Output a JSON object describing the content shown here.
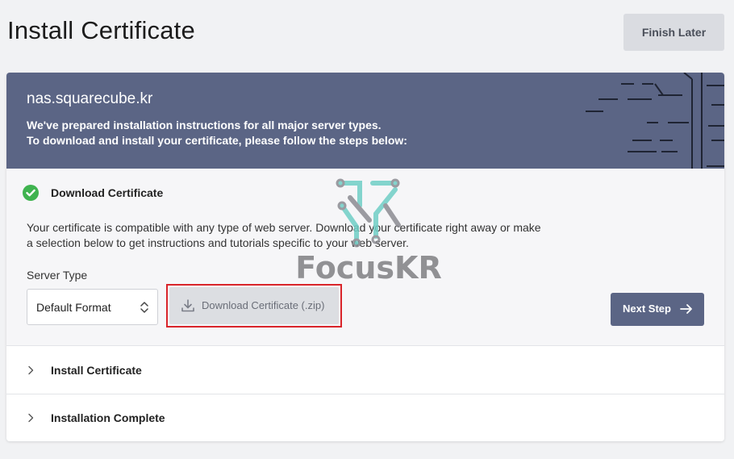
{
  "page": {
    "title": "Install Certificate",
    "finish_later": "Finish Later"
  },
  "banner": {
    "domain": "nas.squarecube.kr",
    "line1": "We've prepared installation instructions for all major server types.",
    "line2": "To download and install your certificate, please follow the steps below:"
  },
  "step1": {
    "title": "Download Certificate",
    "status_icon": "check-circle-icon",
    "description": "Your certificate is compatible with any type of web server. Download your certificate right away or make a selection below to get instructions and tutorials specific to your web server.",
    "server_type_label": "Server Type",
    "server_type_value": "Default Format",
    "download_label": "Download Certificate (.zip)",
    "next_label": "Next Step"
  },
  "steps": [
    {
      "label": "Install Certificate"
    },
    {
      "label": "Installation Complete"
    }
  ],
  "watermark": {
    "text": "FocusKR"
  },
  "colors": {
    "banner": "#5b6585",
    "success": "#3fb34f",
    "highlight_border": "#d9242a",
    "primary_button": "#5b6585"
  }
}
